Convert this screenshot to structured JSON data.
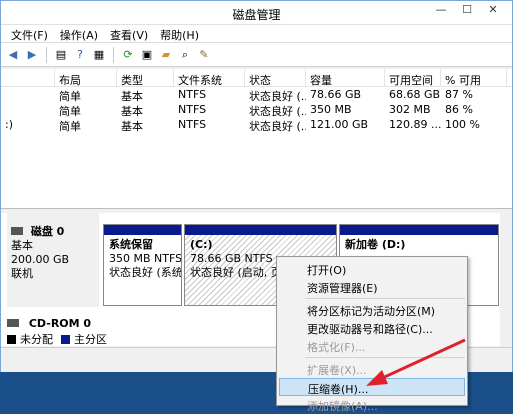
{
  "window": {
    "title": "磁盘管理"
  },
  "menu": [
    "文件(F)",
    "操作(A)",
    "查看(V)",
    "帮助(H)"
  ],
  "columns": [
    "",
    "布局",
    "类型",
    "文件系统",
    "状态",
    "容量",
    "可用空间",
    "% 可用"
  ],
  "rows": [
    [
      "",
      "简单",
      "基本",
      "NTFS",
      "状态良好 (...",
      "78.66 GB",
      "68.68 GB",
      "87 %"
    ],
    [
      "",
      "简单",
      "基本",
      "NTFS",
      "状态良好 (...",
      "350 MB",
      "302 MB",
      "86 %"
    ],
    [
      ":)",
      "简单",
      "基本",
      "NTFS",
      "状态良好 (...",
      "121.00 GB",
      "120.89 ...",
      "100 %"
    ]
  ],
  "disk0": {
    "name": "磁盘 0",
    "type": "基本",
    "size": "200.00 GB",
    "status": "联机",
    "partitions": [
      {
        "name": "系统保留",
        "size": "350 MB NTFS",
        "status": "状态良好 (系统,"
      },
      {
        "name": "(C:)",
        "size": "78.66 GB NTFS",
        "status": "状态良好 (启动, 页面"
      },
      {
        "name": "新加卷 (D:)",
        "size": "",
        "status": ""
      }
    ]
  },
  "cdrom": {
    "name": "CD-ROM 0"
  },
  "legend": [
    {
      "label": "未分配",
      "color": "#000000"
    },
    {
      "label": "主分区",
      "color": "#0a1a8c"
    }
  ],
  "context_menu": [
    {
      "label": "打开(O)",
      "disabled": false
    },
    {
      "label": "资源管理器(E)",
      "disabled": false
    },
    {
      "sep": true
    },
    {
      "label": "将分区标记为活动分区(M)",
      "disabled": false
    },
    {
      "label": "更改驱动器号和路径(C)...",
      "disabled": false
    },
    {
      "label": "格式化(F)...",
      "disabled": true
    },
    {
      "sep": true
    },
    {
      "label": "扩展卷(X)...",
      "disabled": true
    },
    {
      "label": "压缩卷(H)...",
      "disabled": false,
      "highlighted": true
    },
    {
      "label": "添加镜像(A)...",
      "disabled": true
    }
  ],
  "colors": {
    "primary_partition": "#0a1a8c",
    "arrow": "#e0202a",
    "highlight": "#cde4f7"
  }
}
